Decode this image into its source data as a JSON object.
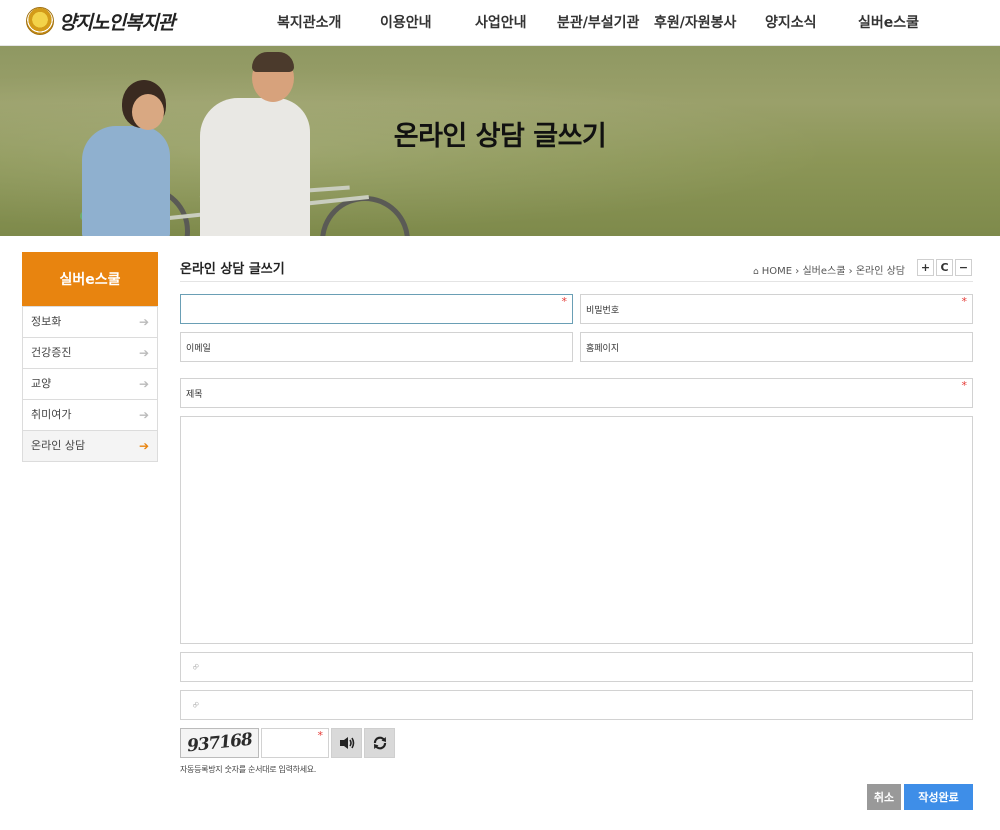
{
  "header": {
    "logo_text": "양지노인복지관",
    "nav": [
      "복지관소개",
      "이용안내",
      "사업안내",
      "분관/부설기관",
      "후원/자원봉사",
      "양지소식",
      "실버e스쿨"
    ]
  },
  "hero": {
    "title": "온라인 상담 글쓰기"
  },
  "sidebar": {
    "title": "실버e스쿨",
    "items": [
      {
        "label": "정보화"
      },
      {
        "label": "건강증진"
      },
      {
        "label": "교양"
      },
      {
        "label": "취미여가"
      },
      {
        "label": "온라인 상담"
      }
    ],
    "active_index": 4
  },
  "content": {
    "title": "온라인 상담 글쓰기",
    "breadcrumb": {
      "home": "HOME",
      "path1": "실버e스쿨",
      "path2": "온라인 상담"
    },
    "tools": [
      "+",
      "C",
      "−"
    ]
  },
  "form": {
    "name": {
      "value": "",
      "required": "*"
    },
    "password": {
      "placeholder": "비밀번호",
      "required": "*"
    },
    "email": {
      "placeholder": "이메일"
    },
    "homepage": {
      "placeholder": "홈페이지"
    },
    "subject": {
      "placeholder": "제목",
      "required": "*"
    },
    "body": {
      "value": ""
    },
    "link1": {
      "value": ""
    },
    "link2": {
      "value": ""
    },
    "captcha": {
      "image_text": "937168",
      "required": "*",
      "help": "자동등록방지 숫자를 순서대로 입력하세요."
    }
  },
  "actions": {
    "cancel_label": "취소",
    "submit_label": "작성완료"
  },
  "colors": {
    "accent_orange": "#e8840f",
    "submit_blue": "#3e8ee8",
    "cancel_gray": "#999999",
    "required_red": "#e53935"
  }
}
